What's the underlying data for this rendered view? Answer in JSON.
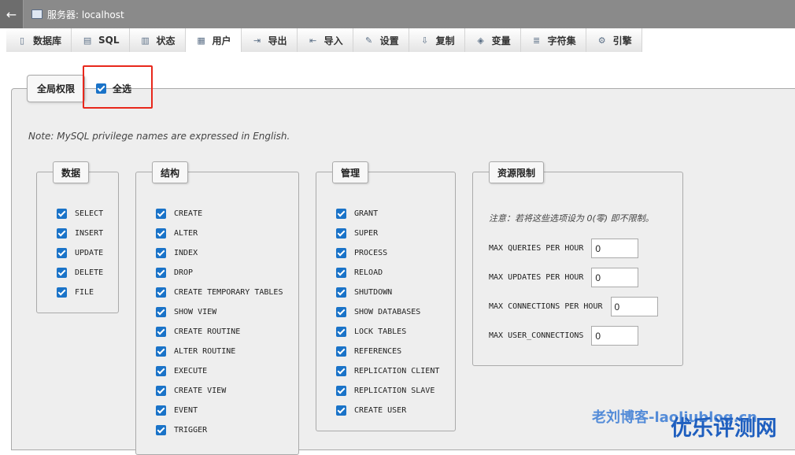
{
  "titlebar": {
    "back": "←",
    "server_label": "服务器: localhost"
  },
  "tabs": [
    {
      "label": "数据库",
      "icon": "▯"
    },
    {
      "label": "SQL",
      "icon": "▤"
    },
    {
      "label": "状态",
      "icon": "▥"
    },
    {
      "label": "用户",
      "icon": "▦"
    },
    {
      "label": "导出",
      "icon": "⇥"
    },
    {
      "label": "导入",
      "icon": "⇤"
    },
    {
      "label": "设置",
      "icon": "✎"
    },
    {
      "label": "复制",
      "icon": "⇩"
    },
    {
      "label": "变量",
      "icon": "◈"
    },
    {
      "label": "字符集",
      "icon": "≣"
    },
    {
      "label": "引擎",
      "icon": "⚙"
    }
  ],
  "global": {
    "legend": "全局权限",
    "select_all": "全选"
  },
  "note": "Note: MySQL privilege names are expressed in English.",
  "groups": {
    "data": {
      "title": "数据",
      "items": [
        "SELECT",
        "INSERT",
        "UPDATE",
        "DELETE",
        "FILE"
      ]
    },
    "structure": {
      "title": "结构",
      "items": [
        "CREATE",
        "ALTER",
        "INDEX",
        "DROP",
        "CREATE TEMPORARY TABLES",
        "SHOW VIEW",
        "CREATE ROUTINE",
        "ALTER ROUTINE",
        "EXECUTE",
        "CREATE VIEW",
        "EVENT",
        "TRIGGER"
      ]
    },
    "admin": {
      "title": "管理",
      "items": [
        "GRANT",
        "SUPER",
        "PROCESS",
        "RELOAD",
        "SHUTDOWN",
        "SHOW DATABASES",
        "LOCK TABLES",
        "REFERENCES",
        "REPLICATION CLIENT",
        "REPLICATION SLAVE",
        "CREATE USER"
      ]
    }
  },
  "resources": {
    "title": "资源限制",
    "note": "注意：若将这些选项设为 0(零) 即不限制。",
    "rows": [
      {
        "label": "MAX QUERIES PER HOUR",
        "value": "0"
      },
      {
        "label": "MAX UPDATES PER HOUR",
        "value": "0"
      },
      {
        "label": "MAX CONNECTIONS PER HOUR",
        "value": "0"
      },
      {
        "label": "MAX USER_CONNECTIONS",
        "value": "0"
      }
    ]
  },
  "watermark": {
    "text1": "老刘博客-laoliublog.cn",
    "text2": "优乐评测网"
  },
  "colors": {
    "highlight": "#e8281c",
    "checkbox": "#1a73c8"
  }
}
